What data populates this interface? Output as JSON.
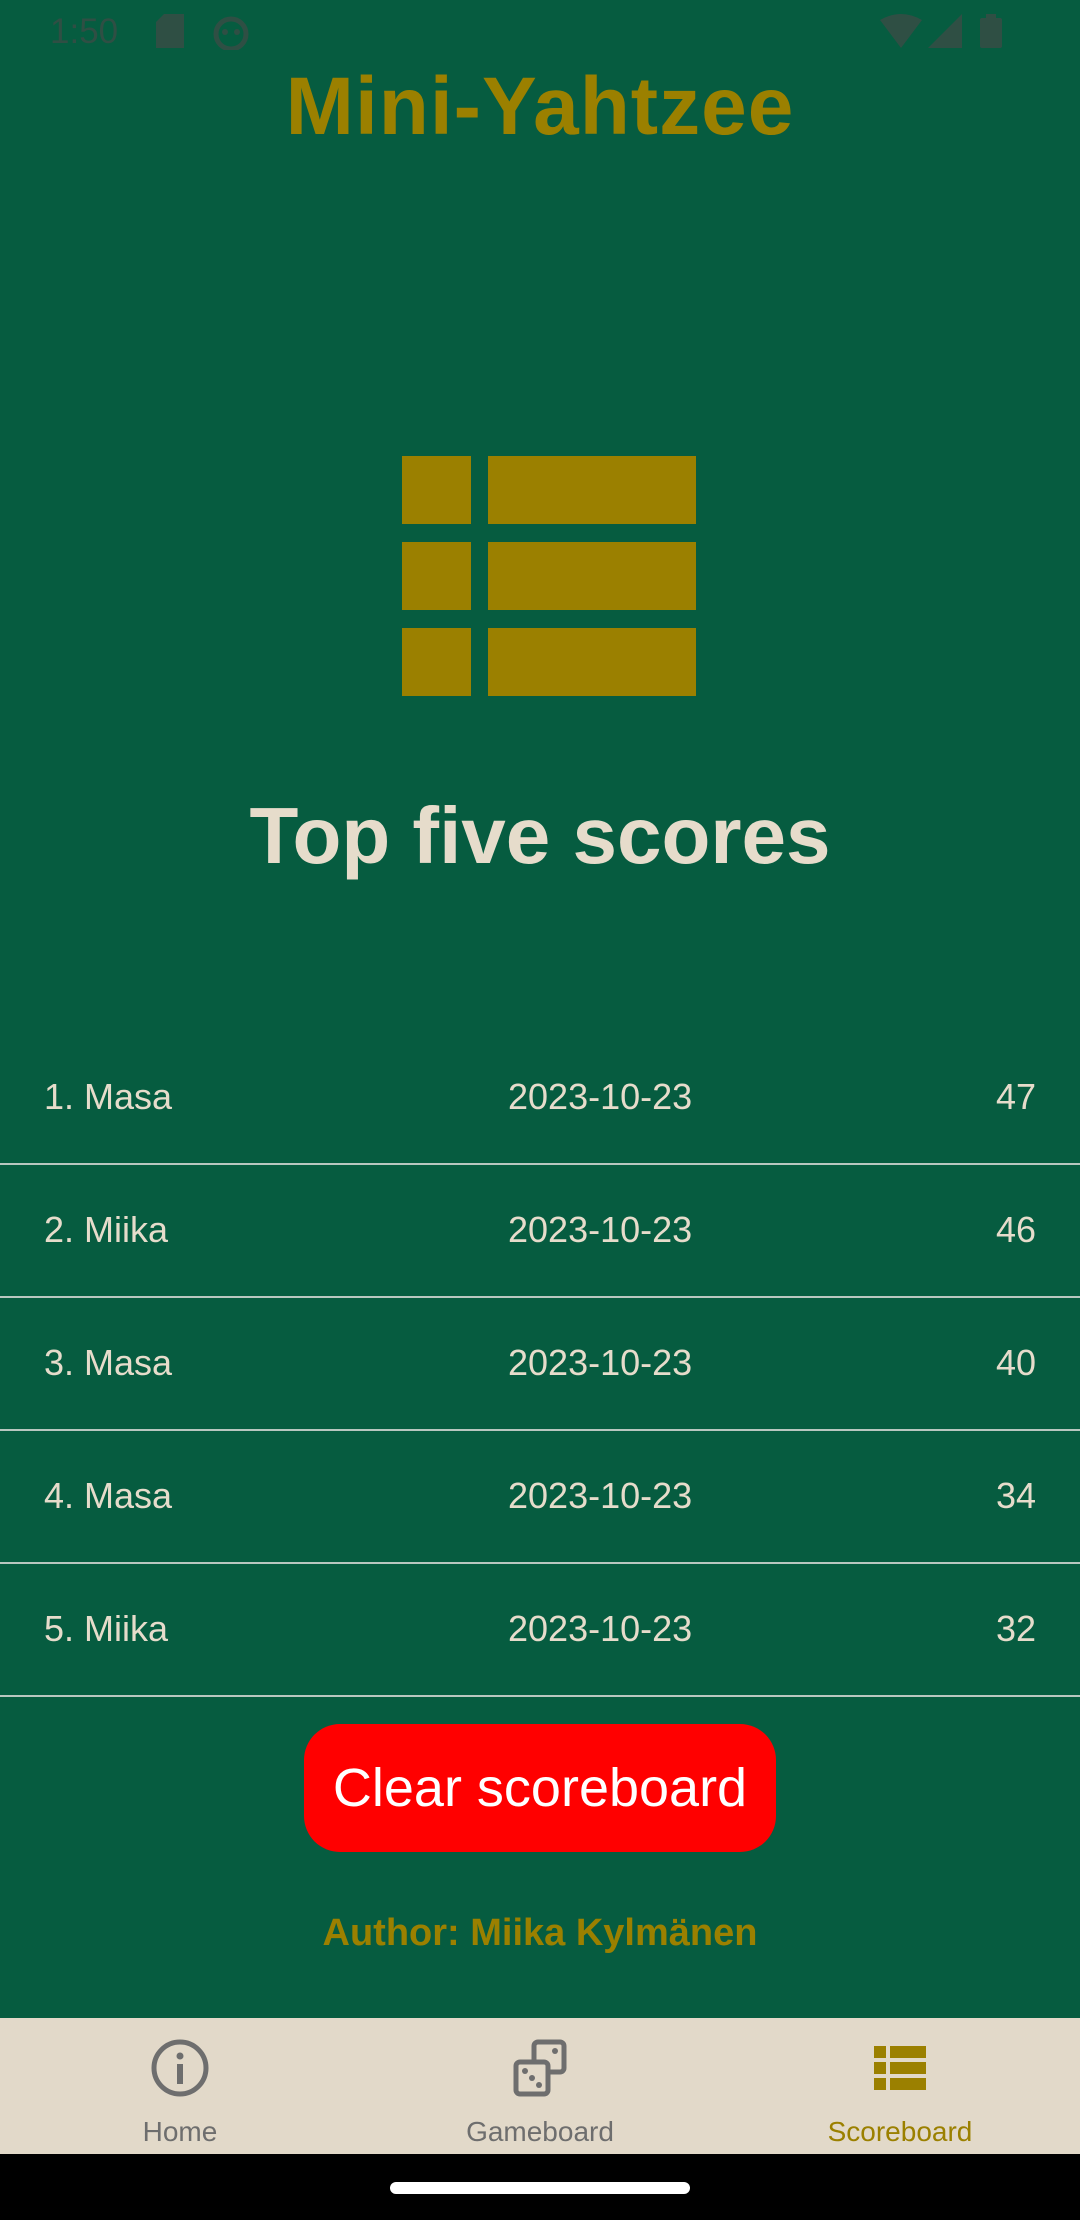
{
  "status_bar": {
    "time": "1:50",
    "icons": [
      "sd-card-icon",
      "android-debug-icon",
      "wifi-icon",
      "signal-icon",
      "battery-icon"
    ]
  },
  "header": {
    "title": "Mini-Yahtzee"
  },
  "main": {
    "icon": "scoreboard-list-icon",
    "heading": "Top five scores",
    "scores": [
      {
        "name": "1. Masa",
        "date": "2023-10-23",
        "score": "47"
      },
      {
        "name": "2. Miika",
        "date": "2023-10-23",
        "score": "46"
      },
      {
        "name": "3. Masa",
        "date": "2023-10-23",
        "score": "40"
      },
      {
        "name": "4. Masa",
        "date": "2023-10-23",
        "score": "34"
      },
      {
        "name": "5. Miika",
        "date": "2023-10-23",
        "score": "32"
      }
    ],
    "clear_button_label": "Clear scoreboard",
    "author": "Author: Miika Kylmänen"
  },
  "bottom_nav": {
    "items": [
      {
        "label": "Home",
        "icon": "info-icon",
        "active": false
      },
      {
        "label": "Gameboard",
        "icon": "dice-icon",
        "active": false
      },
      {
        "label": "Scoreboard",
        "icon": "list-icon",
        "active": true
      }
    ]
  },
  "colors": {
    "background": "#065c40",
    "accent": "#9b8000",
    "text": "#e6dccb",
    "danger": "#ff0000",
    "nav_background": "#e2d9c9"
  }
}
